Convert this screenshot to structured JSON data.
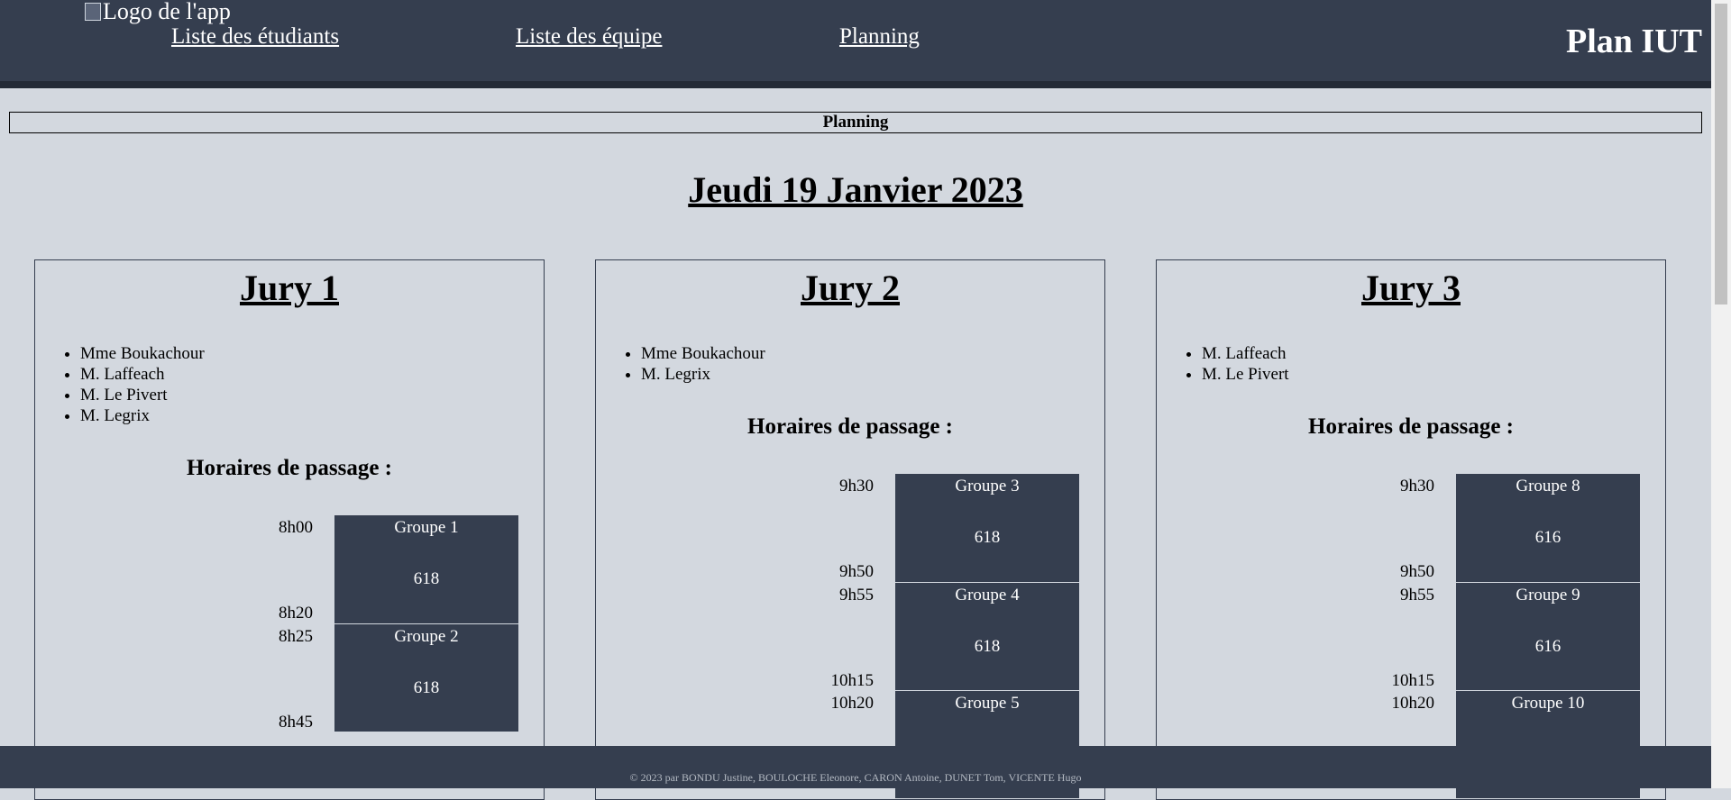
{
  "header": {
    "logo_alt": "Logo de l'app",
    "nav": [
      "Liste des étudiants",
      "Liste des équipe",
      "Planning"
    ],
    "brand": "Plan IUT"
  },
  "section_title": "Planning",
  "date_title": "Jeudi 19 Janvier 2023",
  "juries": [
    {
      "title": "Jury 1",
      "members": [
        "Mme Boukachour",
        "M. Laffeach",
        "M. Le Pivert",
        "M. Legrix"
      ],
      "horaires_label": "Horaires de passage :",
      "slots": [
        {
          "start": "8h00",
          "end": "8h20",
          "group": "Groupe 1",
          "room": "618"
        },
        {
          "start": "8h25",
          "end": "8h45",
          "group": "Groupe 2",
          "room": "618"
        }
      ]
    },
    {
      "title": "Jury 2",
      "members": [
        "Mme Boukachour",
        "M. Legrix"
      ],
      "horaires_label": "Horaires de passage :",
      "slots": [
        {
          "start": "9h30",
          "end": "9h50",
          "group": "Groupe 3",
          "room": "618"
        },
        {
          "start": "9h55",
          "end": "10h15",
          "group": "Groupe 4",
          "room": "618"
        },
        {
          "start": "10h20",
          "end": "",
          "group": "Groupe 5",
          "room": ""
        }
      ]
    },
    {
      "title": "Jury 3",
      "members": [
        "M. Laffeach",
        "M. Le Pivert"
      ],
      "horaires_label": "Horaires de passage :",
      "slots": [
        {
          "start": "9h30",
          "end": "9h50",
          "group": "Groupe 8",
          "room": "616"
        },
        {
          "start": "9h55",
          "end": "10h15",
          "group": "Groupe 9",
          "room": "616"
        },
        {
          "start": "10h20",
          "end": "",
          "group": "Groupe 10",
          "room": ""
        }
      ]
    }
  ],
  "footer": "© 2023 par BONDU Justine, BOULOCHE Eleonore, CARON Antoine, DUNET Tom, VICENTE Hugo"
}
